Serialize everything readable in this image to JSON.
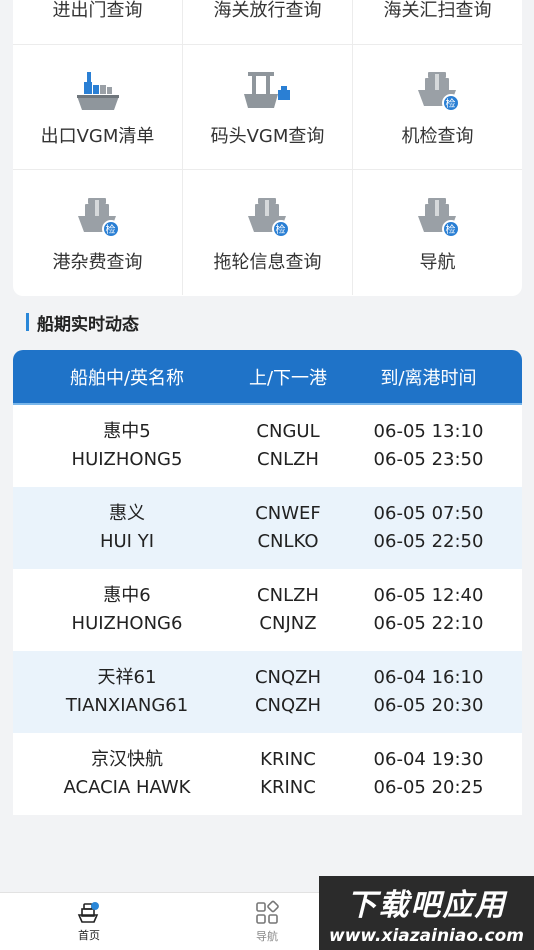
{
  "grid": {
    "rows": [
      [
        {
          "label": "进出门查询",
          "icon": "none"
        },
        {
          "label": "海关放行查询",
          "icon": "none"
        },
        {
          "label": "海关汇扫查询",
          "icon": "none"
        }
      ],
      [
        {
          "label": "出口VGM清单",
          "icon": "container-ship-icon"
        },
        {
          "label": "码头VGM查询",
          "icon": "ship-crane-icon"
        },
        {
          "label": "机检查询",
          "icon": "ship-inspect-icon",
          "badge": "检"
        }
      ],
      [
        {
          "label": "港杂费查询",
          "icon": "ship-inspect-icon",
          "badge": "检"
        },
        {
          "label": "拖轮信息查询",
          "icon": "ship-inspect-icon",
          "badge": "检"
        },
        {
          "label": "导航",
          "icon": "ship-inspect-icon",
          "badge": "检"
        }
      ]
    ]
  },
  "section": {
    "title": "船期实时动态"
  },
  "table": {
    "headers": [
      "船舶中/英名称",
      "上/下一港",
      "到/离港时间"
    ],
    "rows": [
      {
        "cn": "惠中5",
        "en": "HUIZHONG5",
        "port_prev": "CNGUL",
        "port_next": "CNLZH",
        "arrive": "06-05 13:10",
        "depart": "06-05 23:50"
      },
      {
        "cn": "惠义",
        "en": "HUI YI",
        "port_prev": "CNWEF",
        "port_next": "CNLKO",
        "arrive": "06-05 07:50",
        "depart": "06-05 22:50"
      },
      {
        "cn": "惠中6",
        "en": "HUIZHONG6",
        "port_prev": "CNLZH",
        "port_next": "CNJNZ",
        "arrive": "06-05 12:40",
        "depart": "06-05 22:10"
      },
      {
        "cn": "天祥61",
        "en": "TIANXIANG61",
        "port_prev": "CNQZH",
        "port_next": "CNQZH",
        "arrive": "06-04 16:10",
        "depart": "06-05 20:30"
      },
      {
        "cn": "京汉快航",
        "en": "ACACIA HAWK",
        "port_prev": "KRINC",
        "port_next": "KRINC",
        "arrive": "06-04 19:30",
        "depart": "06-05 20:25"
      }
    ]
  },
  "bottom_nav": {
    "items": [
      {
        "label": "首页",
        "icon": "ship-home-icon",
        "active": true
      },
      {
        "label": "导航",
        "icon": "grid-apps-icon",
        "active": false
      }
    ]
  },
  "watermark": {
    "title": "下载吧应用",
    "url": "www.xiazainiao.com"
  },
  "colors": {
    "primary": "#1f73c8",
    "accent": "#2a87d8",
    "alt_row": "#eaf3fb",
    "background": "#f2f3f5"
  }
}
